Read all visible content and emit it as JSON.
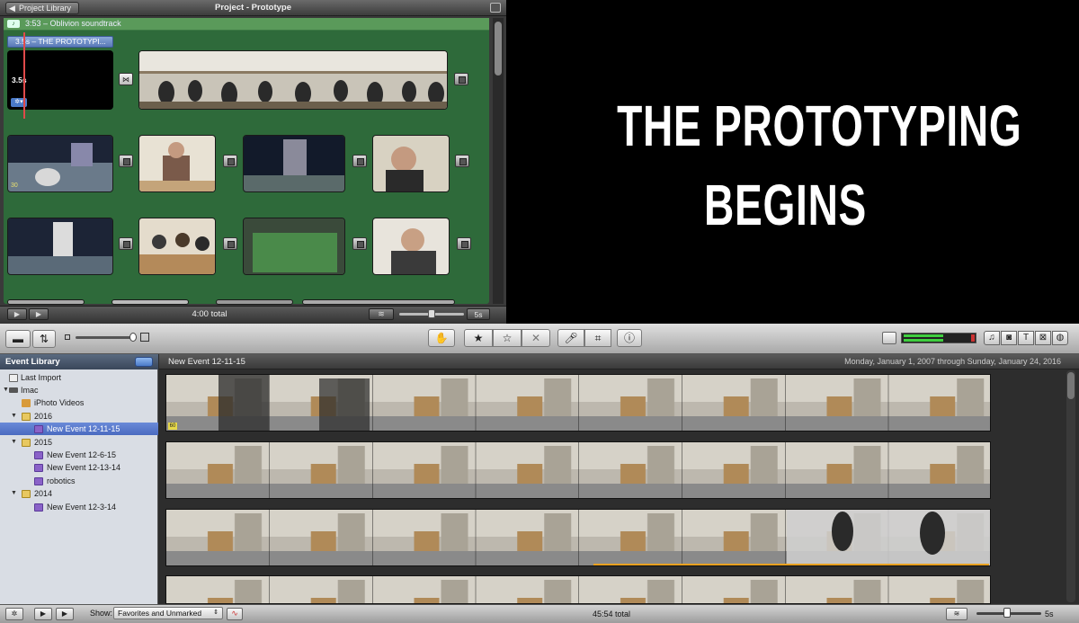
{
  "project": {
    "library_button": "Project Library",
    "title": "Project - Prototype",
    "music_label": "3:53 – Oblivion soundtrack",
    "title_tag": "3.5s – THE PROTOTYPI...",
    "title_clip_duration": "3.5s",
    "clip_badge": "30",
    "total": "4:00 total",
    "zoom_label": "5s"
  },
  "viewer": {
    "line1": "THE PROTOTYPING",
    "line2": "BEGINS"
  },
  "event_library": {
    "title": "Event Library",
    "items": [
      {
        "label": "Last Import"
      },
      {
        "label": "Imac"
      },
      {
        "label": "iPhoto Videos"
      },
      {
        "label": "2016"
      },
      {
        "label": "New Event 12-11-15"
      },
      {
        "label": "2015"
      },
      {
        "label": "New Event 12-6-15"
      },
      {
        "label": "New Event 12-13-14"
      },
      {
        "label": "robotics"
      },
      {
        "label": "2014"
      },
      {
        "label": "New Event 12-3-14"
      }
    ]
  },
  "event_browser": {
    "event_name": "New Event 12-11-15",
    "date_range": "Monday, January 1, 2007 through Sunday, January 24, 2016",
    "first_clip_badge": "60"
  },
  "bottom_bar": {
    "show_label": "Show:",
    "show_value": "Favorites and Unmarked",
    "total": "45:54 total",
    "zoom_label": "5s"
  },
  "colors": {
    "project_green": "#2e6a3a",
    "selection_blue": "#4a6ac0",
    "audio_meter_green": "#3fcf3f",
    "playhead_red": "#e04a4a"
  }
}
